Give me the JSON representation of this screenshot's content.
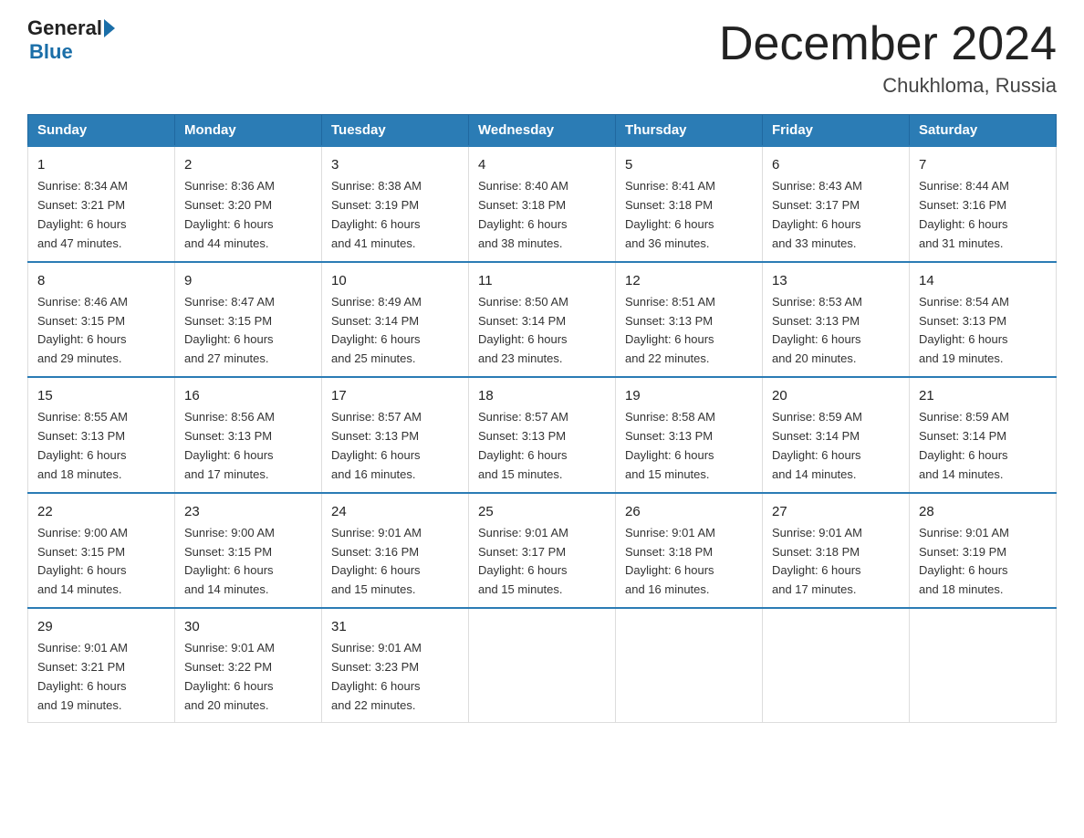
{
  "logo": {
    "general": "General",
    "blue": "Blue"
  },
  "title": "December 2024",
  "subtitle": "Chukhloma, Russia",
  "days_of_week": [
    "Sunday",
    "Monday",
    "Tuesday",
    "Wednesday",
    "Thursday",
    "Friday",
    "Saturday"
  ],
  "weeks": [
    [
      {
        "day": "1",
        "info": "Sunrise: 8:34 AM\nSunset: 3:21 PM\nDaylight: 6 hours\nand 47 minutes."
      },
      {
        "day": "2",
        "info": "Sunrise: 8:36 AM\nSunset: 3:20 PM\nDaylight: 6 hours\nand 44 minutes."
      },
      {
        "day": "3",
        "info": "Sunrise: 8:38 AM\nSunset: 3:19 PM\nDaylight: 6 hours\nand 41 minutes."
      },
      {
        "day": "4",
        "info": "Sunrise: 8:40 AM\nSunset: 3:18 PM\nDaylight: 6 hours\nand 38 minutes."
      },
      {
        "day": "5",
        "info": "Sunrise: 8:41 AM\nSunset: 3:18 PM\nDaylight: 6 hours\nand 36 minutes."
      },
      {
        "day": "6",
        "info": "Sunrise: 8:43 AM\nSunset: 3:17 PM\nDaylight: 6 hours\nand 33 minutes."
      },
      {
        "day": "7",
        "info": "Sunrise: 8:44 AM\nSunset: 3:16 PM\nDaylight: 6 hours\nand 31 minutes."
      }
    ],
    [
      {
        "day": "8",
        "info": "Sunrise: 8:46 AM\nSunset: 3:15 PM\nDaylight: 6 hours\nand 29 minutes."
      },
      {
        "day": "9",
        "info": "Sunrise: 8:47 AM\nSunset: 3:15 PM\nDaylight: 6 hours\nand 27 minutes."
      },
      {
        "day": "10",
        "info": "Sunrise: 8:49 AM\nSunset: 3:14 PM\nDaylight: 6 hours\nand 25 minutes."
      },
      {
        "day": "11",
        "info": "Sunrise: 8:50 AM\nSunset: 3:14 PM\nDaylight: 6 hours\nand 23 minutes."
      },
      {
        "day": "12",
        "info": "Sunrise: 8:51 AM\nSunset: 3:13 PM\nDaylight: 6 hours\nand 22 minutes."
      },
      {
        "day": "13",
        "info": "Sunrise: 8:53 AM\nSunset: 3:13 PM\nDaylight: 6 hours\nand 20 minutes."
      },
      {
        "day": "14",
        "info": "Sunrise: 8:54 AM\nSunset: 3:13 PM\nDaylight: 6 hours\nand 19 minutes."
      }
    ],
    [
      {
        "day": "15",
        "info": "Sunrise: 8:55 AM\nSunset: 3:13 PM\nDaylight: 6 hours\nand 18 minutes."
      },
      {
        "day": "16",
        "info": "Sunrise: 8:56 AM\nSunset: 3:13 PM\nDaylight: 6 hours\nand 17 minutes."
      },
      {
        "day": "17",
        "info": "Sunrise: 8:57 AM\nSunset: 3:13 PM\nDaylight: 6 hours\nand 16 minutes."
      },
      {
        "day": "18",
        "info": "Sunrise: 8:57 AM\nSunset: 3:13 PM\nDaylight: 6 hours\nand 15 minutes."
      },
      {
        "day": "19",
        "info": "Sunrise: 8:58 AM\nSunset: 3:13 PM\nDaylight: 6 hours\nand 15 minutes."
      },
      {
        "day": "20",
        "info": "Sunrise: 8:59 AM\nSunset: 3:14 PM\nDaylight: 6 hours\nand 14 minutes."
      },
      {
        "day": "21",
        "info": "Sunrise: 8:59 AM\nSunset: 3:14 PM\nDaylight: 6 hours\nand 14 minutes."
      }
    ],
    [
      {
        "day": "22",
        "info": "Sunrise: 9:00 AM\nSunset: 3:15 PM\nDaylight: 6 hours\nand 14 minutes."
      },
      {
        "day": "23",
        "info": "Sunrise: 9:00 AM\nSunset: 3:15 PM\nDaylight: 6 hours\nand 14 minutes."
      },
      {
        "day": "24",
        "info": "Sunrise: 9:01 AM\nSunset: 3:16 PM\nDaylight: 6 hours\nand 15 minutes."
      },
      {
        "day": "25",
        "info": "Sunrise: 9:01 AM\nSunset: 3:17 PM\nDaylight: 6 hours\nand 15 minutes."
      },
      {
        "day": "26",
        "info": "Sunrise: 9:01 AM\nSunset: 3:18 PM\nDaylight: 6 hours\nand 16 minutes."
      },
      {
        "day": "27",
        "info": "Sunrise: 9:01 AM\nSunset: 3:18 PM\nDaylight: 6 hours\nand 17 minutes."
      },
      {
        "day": "28",
        "info": "Sunrise: 9:01 AM\nSunset: 3:19 PM\nDaylight: 6 hours\nand 18 minutes."
      }
    ],
    [
      {
        "day": "29",
        "info": "Sunrise: 9:01 AM\nSunset: 3:21 PM\nDaylight: 6 hours\nand 19 minutes."
      },
      {
        "day": "30",
        "info": "Sunrise: 9:01 AM\nSunset: 3:22 PM\nDaylight: 6 hours\nand 20 minutes."
      },
      {
        "day": "31",
        "info": "Sunrise: 9:01 AM\nSunset: 3:23 PM\nDaylight: 6 hours\nand 22 minutes."
      },
      {
        "day": "",
        "info": ""
      },
      {
        "day": "",
        "info": ""
      },
      {
        "day": "",
        "info": ""
      },
      {
        "day": "",
        "info": ""
      }
    ]
  ]
}
